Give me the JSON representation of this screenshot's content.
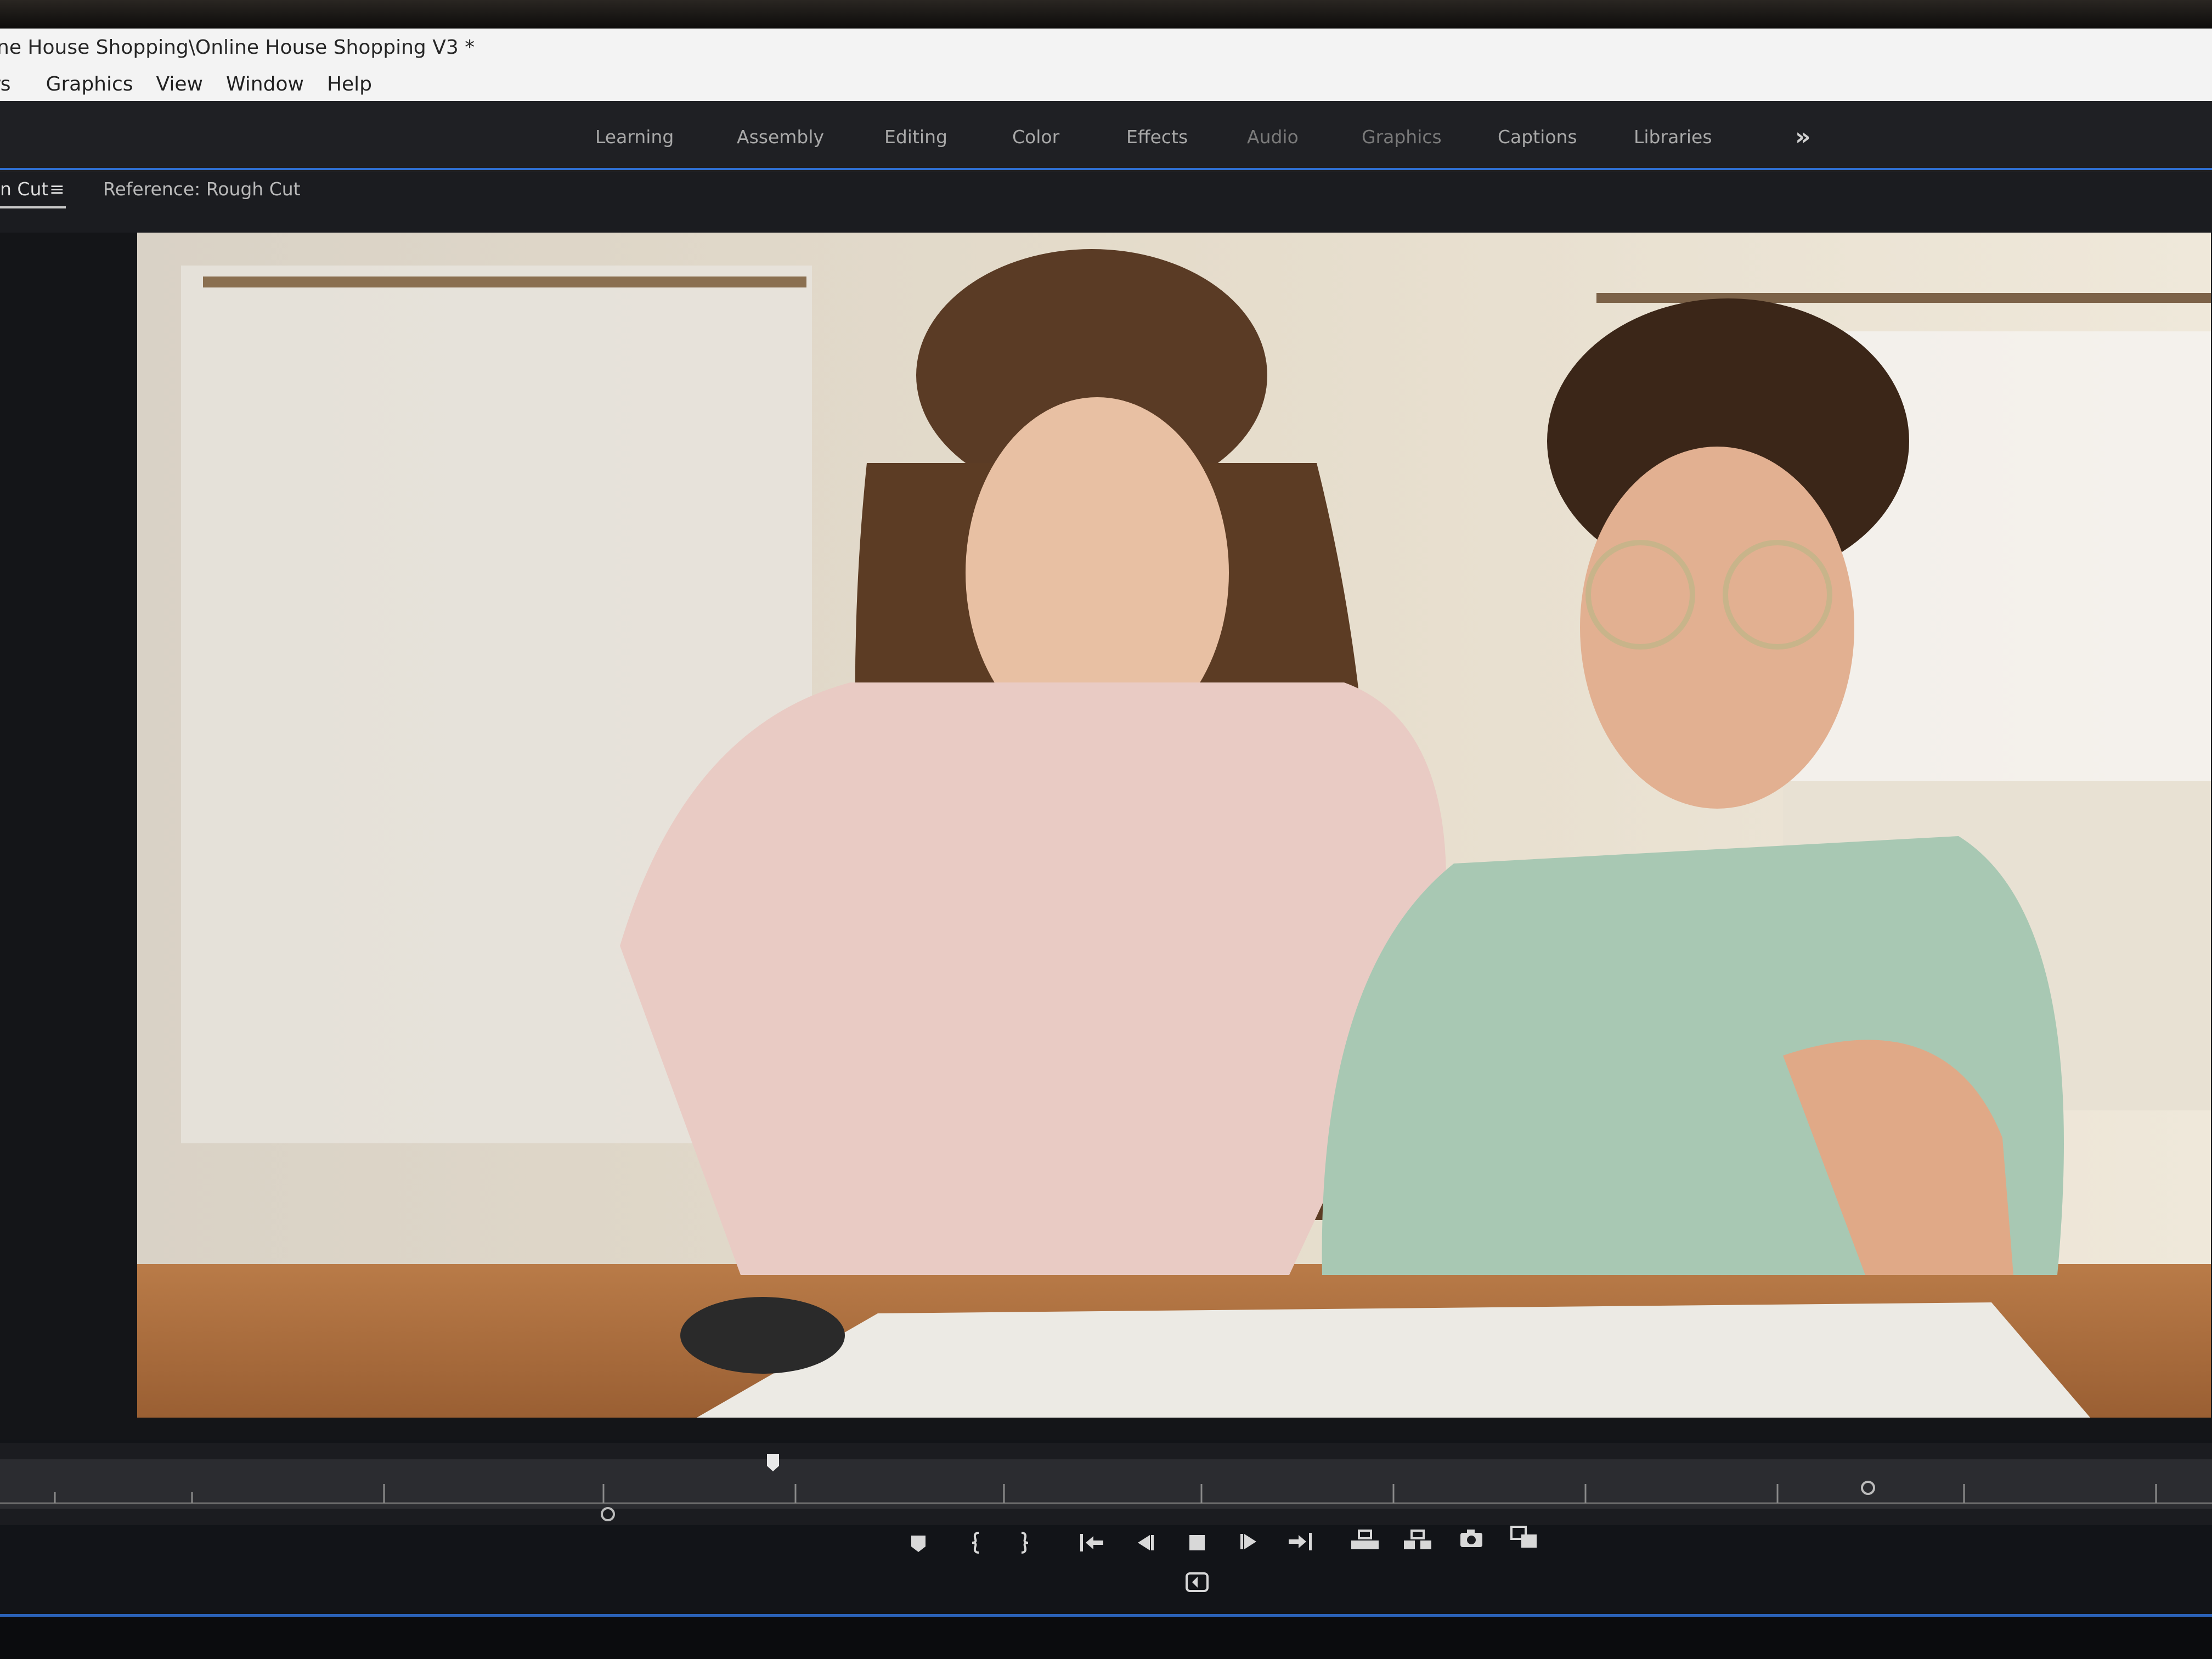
{
  "window": {
    "title": "ne House Shopping\\Online House Shopping V3 *"
  },
  "menu": {
    "items": [
      "rs",
      "Graphics",
      "View",
      "Window",
      "Help"
    ]
  },
  "workspaces": {
    "tabs": [
      "Learning",
      "Assembly",
      "Editing",
      "Color",
      "Effects",
      "Audio",
      "Graphics",
      "Captions",
      "Libraries"
    ],
    "more_icon": "double-chevron-right-icon"
  },
  "program_monitor": {
    "sequence_tab": "n Cut",
    "menu_icon": "hamburger-icon",
    "reference_label": "Reference: Rough Cut",
    "frame_description_icon": "video-frame"
  },
  "transport": {
    "icons": [
      "add-marker-icon",
      "mark-in-icon",
      "mark-out-icon",
      "go-to-in-icon",
      "step-back-icon",
      "stop-icon",
      "step-forward-icon",
      "go-to-out-icon",
      "lift-icon",
      "extract-icon",
      "export-frame-icon",
      "comparison-view-icon",
      "loop-icon"
    ]
  },
  "colors": {
    "accent": "#2f6fd1",
    "panel": "#1f2024",
    "titlebar": "#f3f3f3"
  }
}
